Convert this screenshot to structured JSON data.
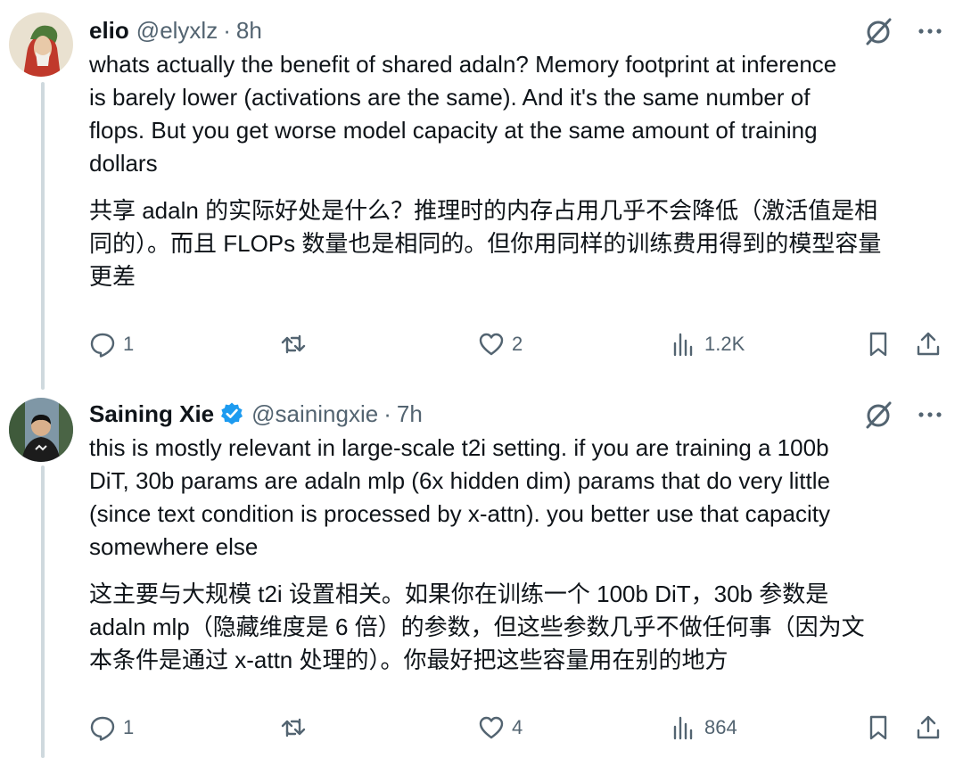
{
  "tweets": [
    {
      "name": "elio",
      "handle": "@elyxlz",
      "dot": "·",
      "time": "8h",
      "verified": false,
      "text_en": "whats actually the benefit of shared adaln? Memory footprint at inference\nis barely lower (activations are the same). And it's the same number of\nflops. But you get worse model capacity at the same amount of training\ndollars",
      "text_zh": "共享 adaln 的实际好处是什么？推理时的内存占用几乎不会降低（激活值是相\n同的）。而且 FLOPs 数量也是相同的。但你用同样的训练费用得到的模型容量\n更差",
      "replies": "1",
      "retweets": "",
      "likes": "2",
      "views": "1.2K"
    },
    {
      "name": "Saining Xie",
      "handle": "@sainingxie",
      "dot": "·",
      "time": "7h",
      "verified": true,
      "text_en": "this is mostly relevant in large-scale t2i setting. if you are training a 100b\nDiT, 30b params are adaln mlp (6x hidden dim) params that do very little\n(since text condition is processed by x-attn). you better use that capacity\nsomewhere else",
      "text_zh": "这主要与大规模 t2i 设置相关。如果你在训练一个 100b DiT，30b 参数是\nadaln mlp（隐藏维度是 6 倍）的参数，但这些参数几乎不做任何事（因为文\n本条件是通过 x-attn 处理的）。你最好把这些容量用在别的地方",
      "replies": "1",
      "retweets": "",
      "likes": "4",
      "views": "864"
    }
  ],
  "icons": {
    "verified": "verified-badge-icon",
    "grok": "grok-icon",
    "more": "more-icon",
    "reply": "reply-icon",
    "retweet": "retweet-icon",
    "like": "heart-icon",
    "views": "views-icon",
    "bookmark": "bookmark-icon",
    "share": "share-icon"
  },
  "colors": {
    "accent": "#1d9bf0",
    "muted": "#536471",
    "text": "#0f1419",
    "thread_line": "#cfd9de"
  }
}
